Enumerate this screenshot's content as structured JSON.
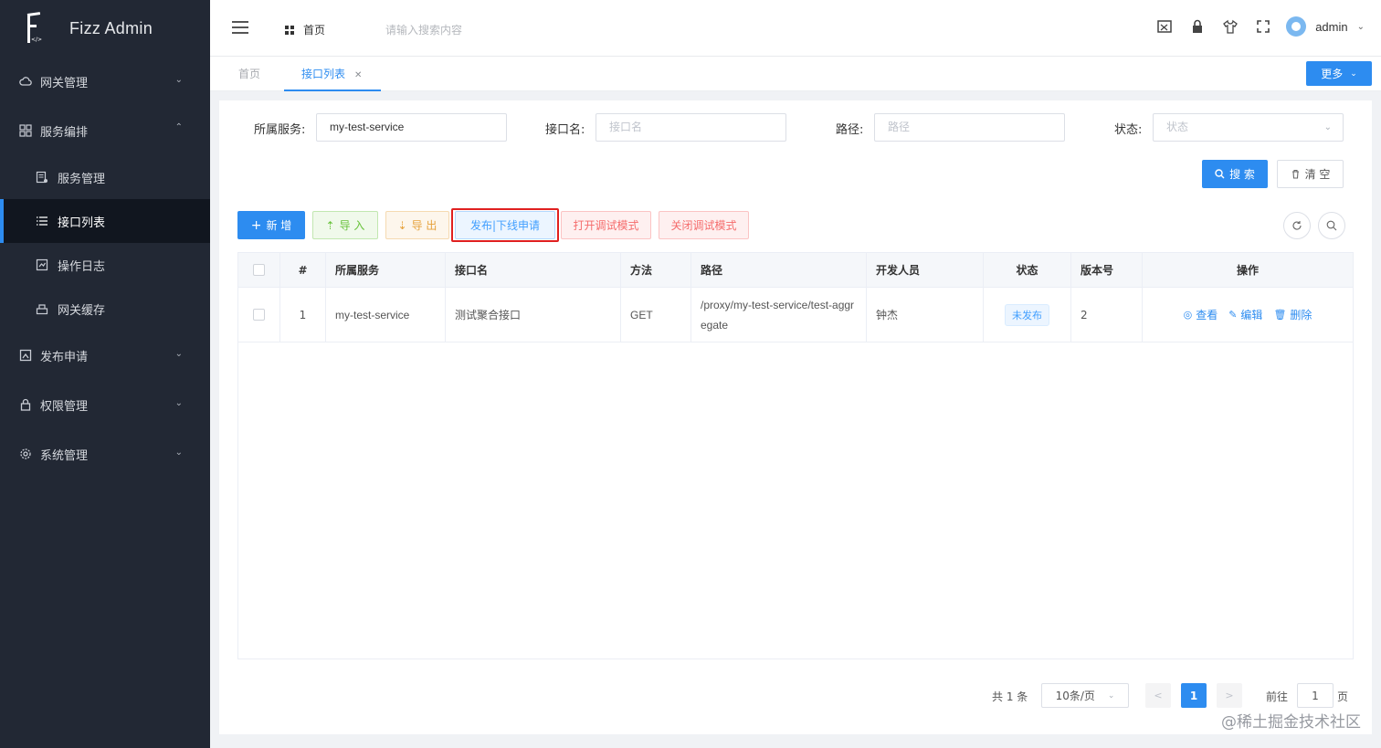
{
  "app": {
    "title": "Fizz Admin"
  },
  "sidebar": {
    "items": [
      {
        "label": "网关管理",
        "icon": "cloud-icon"
      },
      {
        "label": "服务编排",
        "icon": "grid-icon"
      },
      {
        "label": "发布申请",
        "icon": "publish-icon"
      },
      {
        "label": "权限管理",
        "icon": "lock-icon"
      },
      {
        "label": "系统管理",
        "icon": "gear-icon"
      }
    ],
    "subitems": [
      {
        "label": "服务管理",
        "icon": "service-icon"
      },
      {
        "label": "接口列表",
        "icon": "list-icon"
      },
      {
        "label": "操作日志",
        "icon": "log-icon"
      },
      {
        "label": "网关缓存",
        "icon": "cache-icon"
      }
    ]
  },
  "header": {
    "home_label": "首页",
    "search_placeholder": "请输入搜索内容",
    "user_name": "admin"
  },
  "tabs": [
    {
      "label": "首页"
    },
    {
      "label": "接口列表"
    }
  ],
  "more_label": "更多",
  "filters": {
    "service_label": "所属服务:",
    "service_value": "my-test-service",
    "api_label": "接口名:",
    "api_placeholder": "接口名",
    "path_label": "路径:",
    "path_placeholder": "路径",
    "status_label": "状态:",
    "status_placeholder": "状态",
    "search_button": "搜 索",
    "clear_button": "清 空"
  },
  "toolbar": {
    "add": "新 增",
    "import": "导 入",
    "export": "导 出",
    "publish": "发布|下线申请",
    "debug_on": "打开调试模式",
    "debug_off": "关闭调试模式"
  },
  "table": {
    "columns": [
      "#",
      "所属服务",
      "接口名",
      "方法",
      "路径",
      "开发人员",
      "状态",
      "版本号",
      "操作"
    ],
    "rows": [
      {
        "index": "1",
        "service": "my-test-service",
        "name": "测试聚合接口",
        "method": "GET",
        "path": "/proxy/my-test-service/test-aggregate",
        "developer": "钟杰",
        "status": "未发布",
        "version": "2",
        "actions": [
          "查看",
          "编辑",
          "删除"
        ]
      }
    ]
  },
  "pagination": {
    "total": "共 1 条",
    "page_size": "10条/页",
    "current": "1",
    "goto_label": "前往",
    "goto_value": "1",
    "page_suffix": "页"
  },
  "watermark": "@稀土掘金技术社区",
  "colors": {
    "primary": "#2d8cf0",
    "sidebar": "#222834",
    "highlight": "#e02020"
  }
}
